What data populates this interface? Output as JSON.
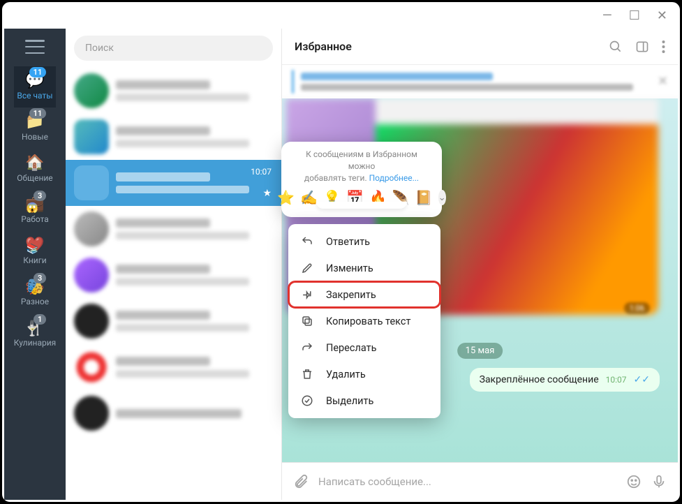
{
  "window": {
    "minimize": "—",
    "maximize": "☐",
    "close": "✕"
  },
  "search": {
    "placeholder": "Поиск"
  },
  "folders": [
    {
      "key": "all",
      "label": "Все чаты",
      "badge": "11",
      "active": true
    },
    {
      "key": "new",
      "label": "Новые",
      "badge": "11"
    },
    {
      "key": "chat",
      "label": "Общение"
    },
    {
      "key": "work",
      "label": "Работа",
      "badge": "3",
      "emoji": "😱"
    },
    {
      "key": "books",
      "label": "Книги",
      "emoji": "📚"
    },
    {
      "key": "misc",
      "label": "Разное",
      "badge": "3",
      "emoji": "🎭"
    },
    {
      "key": "cook",
      "label": "Кулинария",
      "badge": "1",
      "emoji": "🍸"
    }
  ],
  "selected_chat": {
    "time": "10:07"
  },
  "header": {
    "title": "Избранное"
  },
  "date_chip": "15 мая",
  "img_time": "1:06",
  "message": {
    "text": "Закреплённое сообщение",
    "time": "10:07"
  },
  "composer": {
    "placeholder": "Написать сообщение..."
  },
  "popover": {
    "hint_a": "К сообщениям в Избранном можно",
    "hint_b": "добавлять теги. ",
    "hint_link": "Подробнее...",
    "tags": [
      "⭐",
      "✍️",
      "💡",
      "📅",
      "🔥",
      "🪶",
      "📔"
    ]
  },
  "menu": [
    {
      "icon": "reply",
      "label": "Ответить"
    },
    {
      "icon": "edit",
      "label": "Изменить"
    },
    {
      "icon": "pin",
      "label": "Закрепить",
      "hl": true
    },
    {
      "icon": "copy",
      "label": "Копировать текст"
    },
    {
      "icon": "forward",
      "label": "Переслать"
    },
    {
      "icon": "delete",
      "label": "Удалить"
    },
    {
      "icon": "select",
      "label": "Выделить"
    }
  ]
}
